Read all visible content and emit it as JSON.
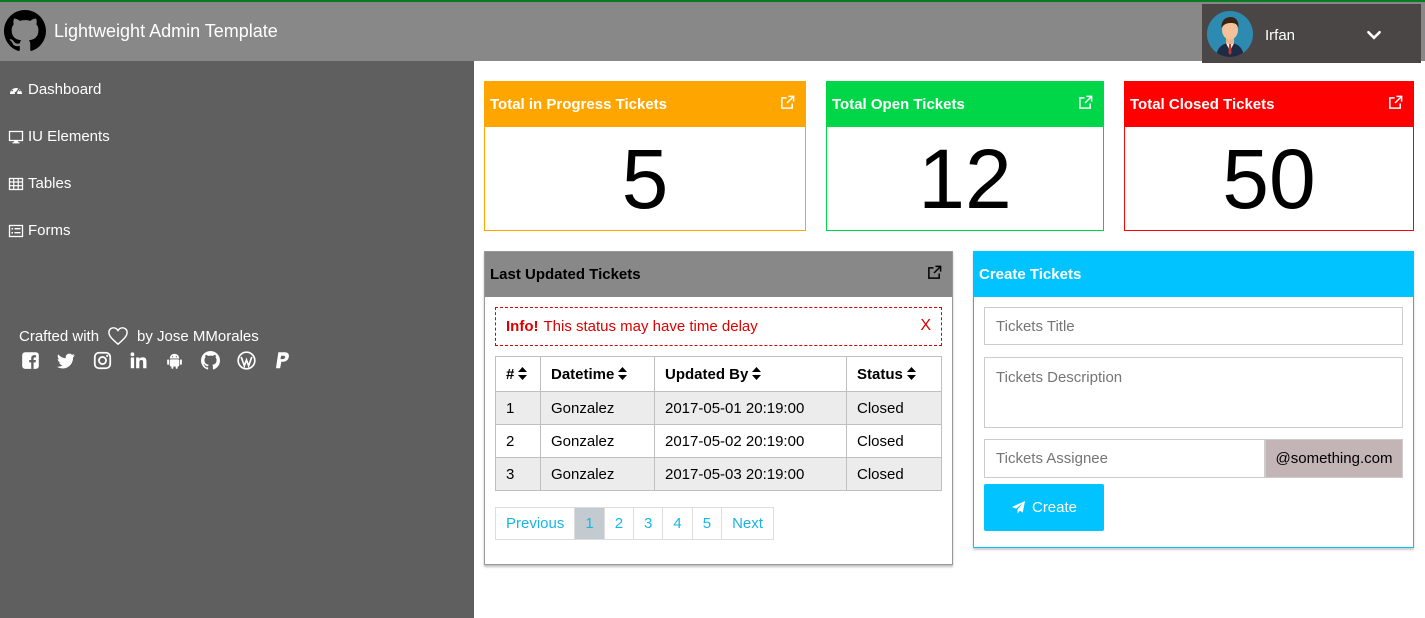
{
  "header": {
    "title": "Lightweight Admin Template",
    "user_name": "Irfan",
    "logo_icon": "github-icon",
    "menu_icon": "chevron-down-icon"
  },
  "sidebar": {
    "items": [
      {
        "label": "Dashboard",
        "icon": "dashboard-icon"
      },
      {
        "label": "IU Elements",
        "icon": "desktop-icon"
      },
      {
        "label": "Tables",
        "icon": "table-icon"
      },
      {
        "label": "Forms",
        "icon": "list-icon"
      }
    ],
    "crafted_prefix": "Crafted with",
    "crafted_suffix": "by Jose MMorales",
    "socials": [
      "facebook-icon",
      "twitter-icon",
      "instagram-icon",
      "linkedin-icon",
      "android-icon",
      "github-icon",
      "wordpress-icon",
      "paypal-icon"
    ]
  },
  "stats": [
    {
      "title": "Total in Progress Tickets",
      "value": "5",
      "color": "#ffa500"
    },
    {
      "title": "Total Open Tickets",
      "value": "12",
      "color": "#00d748"
    },
    {
      "title": "Total Closed Tickets",
      "value": "50",
      "color": "#ff0000"
    }
  ],
  "last_updated": {
    "title": "Last Updated Tickets",
    "info_label": "Info!",
    "info_text": "This status may have time delay",
    "info_close": "X",
    "columns": [
      "#",
      "Datetime",
      "Updated By",
      "Status"
    ],
    "rows": [
      [
        "1",
        "Gonzalez",
        "2017-05-01 20:19:00",
        "Closed"
      ],
      [
        "2",
        "Gonzalez",
        "2017-05-02 20:19:00",
        "Closed"
      ],
      [
        "3",
        "Gonzalez",
        "2017-05-03 20:19:00",
        "Closed"
      ]
    ],
    "pagination": {
      "previous": "Previous",
      "pages": [
        "1",
        "2",
        "3",
        "4",
        "5"
      ],
      "active_page": "1",
      "next": "Next"
    }
  },
  "create": {
    "title": "Create Tickets",
    "title_placeholder": "Tickets Title",
    "description_placeholder": "Tickets Description",
    "assignee_placeholder": "Tickets Assignee",
    "assignee_suffix": "@something.com",
    "button_label": "Create",
    "accent": "#00c3ff"
  }
}
